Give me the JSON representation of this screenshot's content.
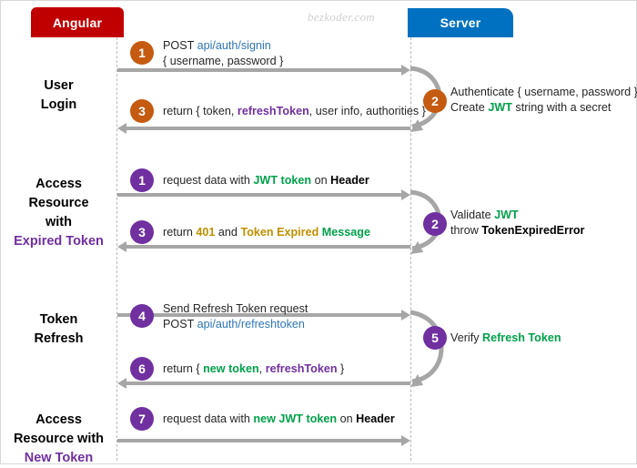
{
  "diagram": {
    "watermark": "bezkoder.com",
    "actors": {
      "client": {
        "label": "Angular",
        "color": "#c00000"
      },
      "server": {
        "label": "Server",
        "color": "#0071c1"
      }
    },
    "colors": {
      "client_box": "#c00000",
      "server_box": "#0071c1",
      "arrow": "#a6a6a6",
      "lifeline": "#b9b9b9",
      "step_orange": "#c55a11",
      "step_purple": "#7030a0",
      "url_blue": "#2e75b6",
      "token_green": "#00a14b",
      "refresh_purple": "#7030a0",
      "warn_gold": "#bf8f00"
    },
    "sections": [
      {
        "name": "user-login",
        "label_lines": [
          "User",
          "Login"
        ],
        "label_highlight": ""
      },
      {
        "name": "access-resource-expired",
        "label_lines": [
          "Access",
          "Resource",
          "with"
        ],
        "label_highlight": "Expired Token"
      },
      {
        "name": "token-refresh",
        "label_lines": [
          "Token",
          "Refresh"
        ],
        "label_highlight": ""
      },
      {
        "name": "access-resource-new",
        "label_lines": [
          "Access",
          "Resource with"
        ],
        "label_highlight": "New Token"
      }
    ],
    "steps": [
      {
        "id": 1,
        "badge": "1",
        "badge_color": "orange",
        "side": "client",
        "direction": "right",
        "lines": [
          [
            {
              "t": "POST ",
              "c": "plain"
            },
            {
              "t": "api/auth/signin",
              "c": "blue"
            }
          ],
          [
            {
              "t": "{ username, password }",
              "c": "plain"
            }
          ]
        ]
      },
      {
        "id": 2,
        "badge": "2",
        "badge_color": "orange",
        "side": "server",
        "direction": "self",
        "lines": [
          [
            {
              "t": "Authenticate { username, password }",
              "c": "plain"
            }
          ],
          [
            {
              "t": "Create ",
              "c": "plain"
            },
            {
              "t": "JWT",
              "c": "green"
            },
            {
              "t": " string with a secret",
              "c": "plain"
            }
          ]
        ]
      },
      {
        "id": 3,
        "badge": "3",
        "badge_color": "orange",
        "side": "client",
        "direction": "left",
        "lines": [
          [
            {
              "t": "return { token, ",
              "c": "plain"
            },
            {
              "t": "refreshToken",
              "c": "purple"
            },
            {
              "t": ", user info, authorities }",
              "c": "plain"
            }
          ]
        ]
      },
      {
        "id": 4,
        "badge": "1",
        "badge_color": "purple",
        "side": "client",
        "direction": "right",
        "lines": [
          [
            {
              "t": "request data with ",
              "c": "plain"
            },
            {
              "t": "JWT token",
              "c": "green"
            },
            {
              "t": " on ",
              "c": "plain"
            },
            {
              "t": "Header",
              "c": "bold"
            }
          ]
        ]
      },
      {
        "id": 5,
        "badge": "2",
        "badge_color": "purple",
        "side": "server",
        "direction": "self",
        "lines": [
          [
            {
              "t": "Validate ",
              "c": "plain"
            },
            {
              "t": "JWT",
              "c": "green"
            }
          ],
          [
            {
              "t": "throw ",
              "c": "plain"
            },
            {
              "t": "TokenExpiredError",
              "c": "bold"
            }
          ]
        ]
      },
      {
        "id": 6,
        "badge": "3",
        "badge_color": "purple",
        "side": "client",
        "direction": "left",
        "lines": [
          [
            {
              "t": "return ",
              "c": "plain"
            },
            {
              "t": "401",
              "c": "gold"
            },
            {
              "t": " and ",
              "c": "plain"
            },
            {
              "t": "Token Expired",
              "c": "gold"
            },
            {
              "t": " ",
              "c": "plain"
            },
            {
              "t": "Message",
              "c": "green"
            }
          ]
        ]
      },
      {
        "id": 7,
        "badge": "4",
        "badge_color": "purple",
        "side": "client",
        "direction": "right",
        "lines": [
          [
            {
              "t": "Send Refresh Token request",
              "c": "plain"
            }
          ],
          [
            {
              "t": "POST ",
              "c": "plain"
            },
            {
              "t": "api/auth/refreshtoken",
              "c": "blue"
            }
          ]
        ]
      },
      {
        "id": 8,
        "badge": "5",
        "badge_color": "purple",
        "side": "server",
        "direction": "self",
        "lines": [
          [
            {
              "t": "Verify ",
              "c": "plain"
            },
            {
              "t": "Refresh Token",
              "c": "green"
            }
          ]
        ]
      },
      {
        "id": 9,
        "badge": "6",
        "badge_color": "purple",
        "side": "client",
        "direction": "left",
        "lines": [
          [
            {
              "t": "return { ",
              "c": "plain"
            },
            {
              "t": "new token",
              "c": "green"
            },
            {
              "t": ", ",
              "c": "plain"
            },
            {
              "t": "refreshToken",
              "c": "purple"
            },
            {
              "t": " }",
              "c": "plain"
            }
          ]
        ]
      },
      {
        "id": 10,
        "badge": "7",
        "badge_color": "purple",
        "side": "client",
        "direction": "right",
        "lines": [
          [
            {
              "t": "request data with ",
              "c": "plain"
            },
            {
              "t": "new JWT token",
              "c": "green"
            },
            {
              "t": " on ",
              "c": "plain"
            },
            {
              "t": "Header",
              "c": "bold"
            }
          ]
        ]
      }
    ]
  }
}
